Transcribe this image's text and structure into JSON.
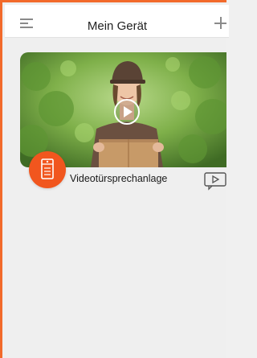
{
  "header": {
    "title": "Mein Gerät",
    "menu_icon": "hamburger-menu-icon",
    "add_icon": "plus-icon"
  },
  "device": {
    "name": "Videotürsprechanlage",
    "icon": "door-intercom-icon",
    "play_icon": "play-icon",
    "playback_icon": "video-playback-icon",
    "accent_color": "#f1561e"
  },
  "colors": {
    "frame_border": "#f26a2b",
    "background": "#efefef",
    "header_background": "#ffffff"
  }
}
